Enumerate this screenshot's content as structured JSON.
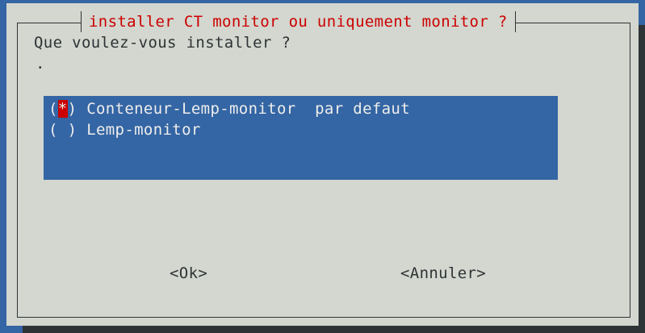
{
  "dialog": {
    "title": "installer CT monitor ou uniquement monitor ?",
    "prompt": "Que voulez-vous installer ?",
    "prompt_continuation": "."
  },
  "options": [
    {
      "label": "Conteneur-Lemp-monitor  par defaut",
      "selected": true,
      "marker": "*"
    },
    {
      "label": "Lemp-monitor",
      "selected": false,
      "marker": " "
    }
  ],
  "buttons": {
    "ok_label": "<Ok>",
    "cancel_label": "<Annuler>"
  },
  "colors": {
    "background": "#3465a4",
    "dialog": "#d3d7cf",
    "title": "#cc0000",
    "list_background": "#3465a4",
    "selected_marker": "#cc0000"
  }
}
